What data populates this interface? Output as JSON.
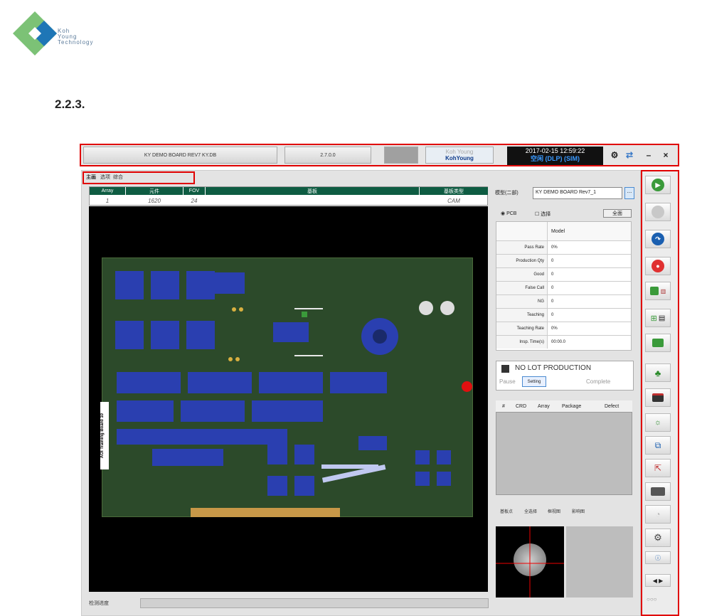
{
  "header": {
    "logo_lines": [
      "Koh",
      "Young",
      "Technology"
    ],
    "section": "2.2.3."
  },
  "topbar": {
    "board_file": "KY DEMO BOARD REV7 KY.DB",
    "version": "2.7.0.0",
    "brand_top": "Koh Young",
    "brand_bottom": "KohYoung",
    "datetime": "2017-02-15 12:59:22",
    "status": "空闲 (DLP) (SIM)",
    "buttons": [
      "settings",
      "refresh",
      "minimize",
      "close"
    ]
  },
  "tabs": [
    "主画",
    "选项",
    "综合"
  ],
  "info_table": {
    "headers": [
      "Array",
      "元件",
      "FOV",
      "基板",
      "基板类型"
    ],
    "values": [
      "1",
      "1620",
      "24",
      "",
      "CAM"
    ]
  },
  "pcb": {
    "board_label": "AOI Training Board 10"
  },
  "model": {
    "label": "模型(二部)",
    "value": "KY DEMO BOARD Rev7_1",
    "browse": "..."
  },
  "mode": {
    "pcb": "PCB",
    "other": "选择",
    "select_button": "全面"
  },
  "stats": {
    "header": "Model",
    "rows": [
      {
        "label": "Pass Rate",
        "value": "0%"
      },
      {
        "label": "Production Qty",
        "value": "0"
      },
      {
        "label": "Good",
        "value": "0"
      },
      {
        "label": "False Call",
        "value": "0"
      },
      {
        "label": "NG",
        "value": "0"
      },
      {
        "label": "Teaching",
        "value": "0"
      },
      {
        "label": "Teaching Rate",
        "value": "0%"
      },
      {
        "label": "Insp. Time(s)",
        "value": "00:00.0"
      }
    ]
  },
  "lot": {
    "title": "NO LOT PRODUCTION",
    "pause": "Pause",
    "setting": "Setting",
    "complete": "Complete"
  },
  "defects": {
    "headers": [
      "#",
      "CRD",
      "Array",
      "Package",
      "Defect"
    ]
  },
  "bottom_tabs": [
    "基板点",
    "全选择",
    "框视图",
    "影响图"
  ],
  "status_label": "检测进度",
  "colors": {
    "board": "#2c4a2a",
    "accent_green": "#0e5c42",
    "frame_red": "#e00000"
  }
}
